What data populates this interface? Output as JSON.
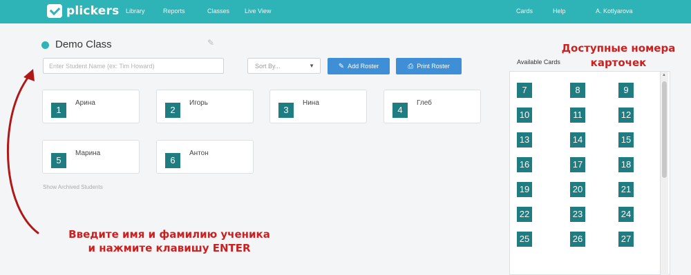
{
  "header": {
    "logo_text": "plickers",
    "nav_left": [
      "Library",
      "Reports",
      "Classes",
      "Live View"
    ],
    "nav_right": [
      "Cards",
      "Help",
      "A. Kotlyarova"
    ]
  },
  "class": {
    "title": "Demo Class"
  },
  "toolbar": {
    "name_placeholder": "Enter Student Name (ex: Tim Howard)",
    "sort_label": "Sort By...",
    "add_roster_label": "Add Roster",
    "print_roster_label": "Print Roster"
  },
  "students": [
    {
      "num": "1",
      "name": "Арина"
    },
    {
      "num": "2",
      "name": "Игорь"
    },
    {
      "num": "3",
      "name": "Нина"
    },
    {
      "num": "4",
      "name": "Глеб"
    },
    {
      "num": "5",
      "name": "Марина"
    },
    {
      "num": "6",
      "name": "Антон"
    }
  ],
  "archived_link": "Show Archived Students",
  "available": {
    "label": "Available Cards",
    "cards": [
      "7",
      "8",
      "9",
      "10",
      "11",
      "12",
      "13",
      "14",
      "15",
      "16",
      "17",
      "18",
      "19",
      "20",
      "21",
      "22",
      "23",
      "24",
      "25",
      "26",
      "27"
    ]
  },
  "annotations": {
    "bottom_line1": "Введите имя  и фамилию ученика",
    "bottom_line2": "и нажмите клавишу ENTER",
    "right_line1": "Доступные номера",
    "right_line2": "карточек"
  },
  "colors": {
    "header": "#2eb3b6",
    "card_tile": "#1f7c80",
    "button": "#3f8fd6",
    "annotation": "#cc1f1f"
  }
}
